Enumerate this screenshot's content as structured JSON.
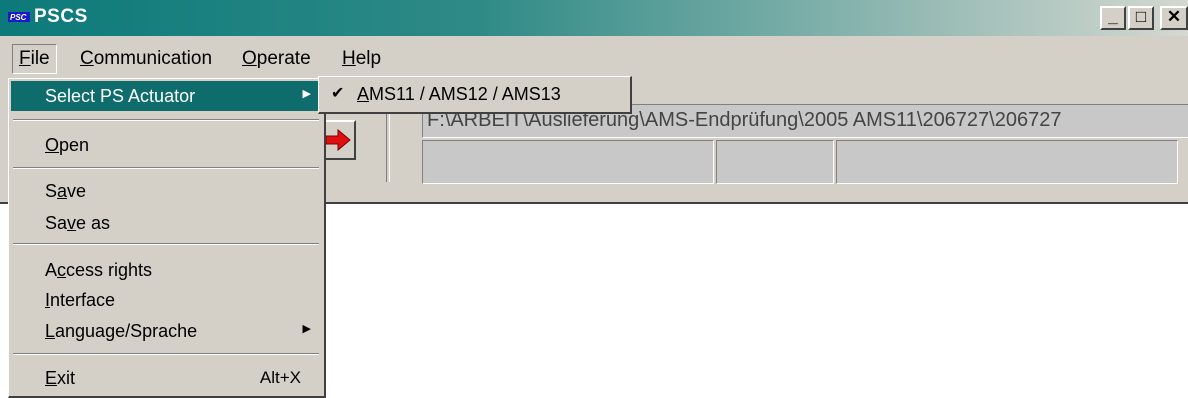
{
  "window": {
    "title": "PSCS",
    "min_glyph": "_",
    "max_glyph": "□",
    "close_glyph": "✕"
  },
  "menubar": {
    "file": {
      "label_u": "F",
      "label_rest": "ile"
    },
    "communication": {
      "label_u": "C",
      "label_rest": "ommunication"
    },
    "operate": {
      "label_u": "O",
      "label_rest": "perate"
    },
    "help": {
      "label_u": "H",
      "label_rest": "elp"
    }
  },
  "toolbar": {
    "path_text": "F:\\ARBEIT\\Auslieferung\\AMS-Endprüfung\\2005 AMS11\\206727\\206727"
  },
  "file_menu": {
    "items": [
      {
        "label": "Select PS Actuator",
        "highlighted": true,
        "has_submenu": true
      },
      {
        "label_u": "O",
        "label_rest": "pen"
      },
      {
        "label_pre": "S",
        "label_u": "a",
        "label_rest": "ve"
      },
      {
        "label_pre": "Sa",
        "label_u": "v",
        "label_rest": "e as"
      },
      {
        "label_pre": "A",
        "label_u": "c",
        "label_rest": "cess rights"
      },
      {
        "label_u": "I",
        "label_rest": "nterface"
      },
      {
        "label_u": "L",
        "label_rest": "anguage/Sprache",
        "has_submenu": true
      },
      {
        "label_u": "E",
        "label_rest": "xit",
        "shortcut": "Alt+X"
      }
    ]
  },
  "submenu": {
    "checked": true,
    "label_u": "A",
    "label_rest": "MS11 / AMS12 / AMS13"
  },
  "icons": {
    "app_icon": "pscs-logo-icon",
    "arrow_button_icon": "red-right-arrow-icon",
    "check_icon": "checkmark-icon",
    "submenu_arrow": "triangle-right-icon"
  },
  "colors": {
    "menu_highlight": "#0f6c6c",
    "title_gradient_start": "#0c7a7a",
    "face": "#d4d0c8"
  }
}
